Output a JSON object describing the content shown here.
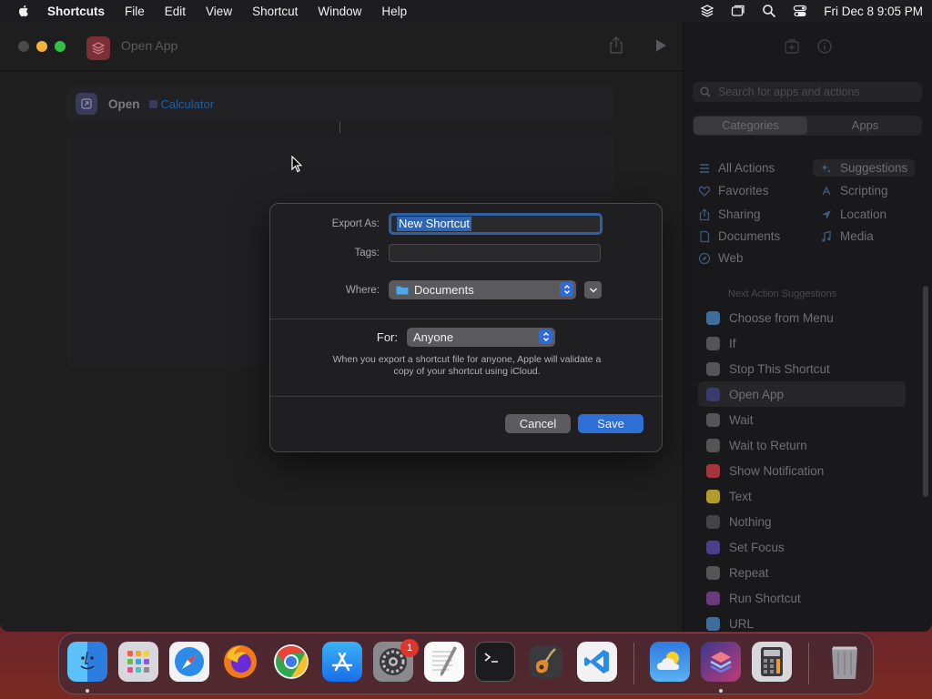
{
  "menubar": {
    "app_name": "Shortcuts",
    "menus": [
      "File",
      "Edit",
      "View",
      "Shortcut",
      "Window",
      "Help"
    ],
    "datetime": "Fri Dec 8  9:05 PM"
  },
  "window": {
    "title": "Open App"
  },
  "editor": {
    "action_verb": "Open",
    "action_app": "Calculator"
  },
  "panel": {
    "search_placeholder": "Search for apps and actions",
    "segments": [
      "Categories",
      "Apps"
    ],
    "categories_left": [
      "All Actions",
      "Favorites",
      "Sharing",
      "Documents",
      "Web"
    ],
    "categories_right": [
      "Suggestions",
      "Scripting",
      "Location",
      "Media"
    ],
    "next_suggestions_label": "Next Action Suggestions",
    "suggestions": [
      {
        "label": "Choose from Menu",
        "color": "#3f6e9a"
      },
      {
        "label": "If",
        "color": "#555558"
      },
      {
        "label": "Stop This Shortcut",
        "color": "#555558"
      },
      {
        "label": "Open App",
        "color": "#3a3b6a"
      },
      {
        "label": "Wait",
        "color": "#555558"
      },
      {
        "label": "Wait to Return",
        "color": "#555558"
      },
      {
        "label": "Show Notification",
        "color": "#a3363a"
      },
      {
        "label": "Text",
        "color": "#b39a2e"
      },
      {
        "label": "Nothing",
        "color": "#444446"
      },
      {
        "label": "Set Focus",
        "color": "#4b3f8a"
      },
      {
        "label": "Repeat",
        "color": "#555558"
      },
      {
        "label": "Run Shortcut",
        "color": "#6a3a7a"
      },
      {
        "label": "URL",
        "color": "#3f6e9a"
      }
    ]
  },
  "dialog": {
    "export_label": "Export As:",
    "export_value": "New Shortcut",
    "tags_label": "Tags:",
    "tags_value": "",
    "where_label": "Where:",
    "where_value": "Documents",
    "for_label": "For:",
    "for_value": "Anyone",
    "note": "When you export a shortcut file for anyone, Apple will validate a copy of your shortcut using iCloud.",
    "cancel": "Cancel",
    "save": "Save"
  },
  "dock": {
    "settings_badge": "1",
    "apps": [
      "finder-icon",
      "launchpad-icon",
      "safari-icon",
      "firefox-icon",
      "chrome-icon",
      "app-store-icon",
      "system-settings-icon",
      "textedit-icon",
      "terminal-icon",
      "garageband-icon",
      "vscode-icon",
      "weather-icon",
      "shortcuts-icon",
      "calculator-icon",
      "trash-icon"
    ]
  },
  "colors": {
    "accent": "#2e6fd6",
    "window_bg": "#1e1e1e",
    "panel_bg": "#19191b"
  }
}
